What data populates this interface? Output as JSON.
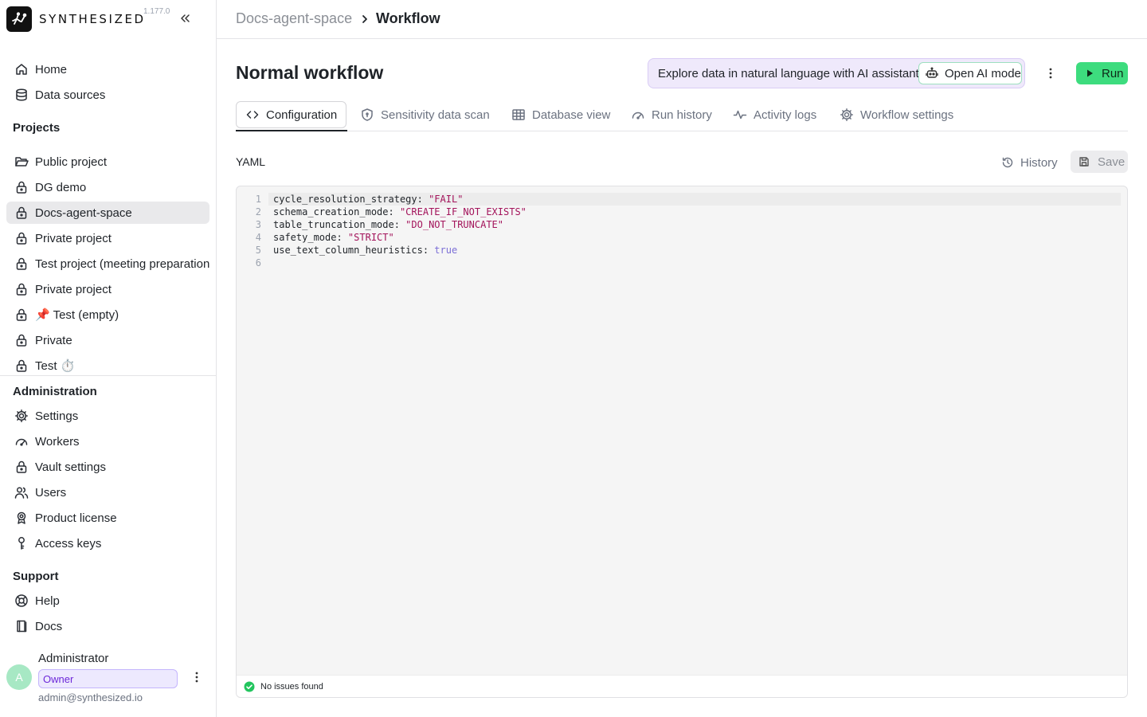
{
  "app": {
    "brand_name": "SYNTHESIZED",
    "version": "1.177.0"
  },
  "sidebar": {
    "top_items": [
      {
        "label": "Home",
        "icon": "home-icon"
      },
      {
        "label": "Data sources",
        "icon": "database-icon"
      }
    ],
    "projects_title": "Projects",
    "projects": [
      {
        "label": "Public project",
        "icon": "folder-open-icon",
        "active": false
      },
      {
        "label": "DG demo",
        "icon": "lock-icon",
        "active": false
      },
      {
        "label": "Docs-agent-space",
        "icon": "lock-icon",
        "active": true
      },
      {
        "label": "Private project",
        "icon": "lock-icon",
        "active": false
      },
      {
        "label": "Test project (meeting preparation",
        "icon": "lock-icon",
        "active": false
      },
      {
        "label": "Private project",
        "icon": "lock-icon",
        "active": false
      },
      {
        "label": "📌 Test (empty)",
        "icon": "lock-icon",
        "active": false
      },
      {
        "label": "Private",
        "icon": "lock-icon",
        "active": false
      },
      {
        "label": "Test ⏱️",
        "icon": "lock-icon",
        "active": false
      }
    ],
    "administration_title": "Administration",
    "administration": [
      {
        "label": "Settings",
        "icon": "gear-icon"
      },
      {
        "label": "Workers",
        "icon": "gauge-icon"
      },
      {
        "label": "Vault settings",
        "icon": "lock-icon"
      },
      {
        "label": "Users",
        "icon": "users-icon"
      },
      {
        "label": "Product license",
        "icon": "award-icon"
      },
      {
        "label": "Access keys",
        "icon": "key-icon"
      }
    ],
    "support_title": "Support",
    "support": [
      {
        "label": "Help",
        "icon": "lifebuoy-icon"
      },
      {
        "label": "Docs",
        "icon": "book-icon"
      }
    ],
    "user": {
      "avatar_letter": "A",
      "name": "Administrator",
      "role": "Owner",
      "email": "admin@synthesized.io"
    }
  },
  "breadcrumb": {
    "parent": "Docs-agent-space",
    "current": "Workflow"
  },
  "page": {
    "title": "Normal workflow",
    "ai_banner_text": "Explore data in natural language with AI assistant",
    "ai_button_label": "Open AI mode",
    "run_label": "Run"
  },
  "tabs": [
    {
      "label": "Configuration",
      "icon": "code-icon",
      "active": true
    },
    {
      "label": "Sensitivity data scan",
      "icon": "shield-icon",
      "active": false
    },
    {
      "label": "Database view",
      "icon": "table-icon",
      "active": false
    },
    {
      "label": "Run history",
      "icon": "gauge-icon",
      "active": false
    },
    {
      "label": "Activity logs",
      "icon": "activity-icon",
      "active": false
    },
    {
      "label": "Workflow settings",
      "icon": "gear-icon",
      "active": false
    }
  ],
  "editor": {
    "label": "YAML",
    "history_label": "History",
    "save_label": "Save",
    "lines": [
      {
        "num": "1",
        "key": "cycle_resolution_strategy: ",
        "value": "\"FAIL\"",
        "type": "string"
      },
      {
        "num": "2",
        "key": "schema_creation_mode: ",
        "value": "\"CREATE_IF_NOT_EXISTS\"",
        "type": "string"
      },
      {
        "num": "3",
        "key": "table_truncation_mode: ",
        "value": "\"DO_NOT_TRUNCATE\"",
        "type": "string"
      },
      {
        "num": "4",
        "key": "safety_mode: ",
        "value": "\"STRICT\"",
        "type": "string"
      },
      {
        "num": "5",
        "key": "use_text_column_heuristics: ",
        "value": "true",
        "type": "bool"
      },
      {
        "num": "6",
        "key": "",
        "value": "",
        "type": "empty"
      }
    ],
    "status_text": "No issues found"
  },
  "colors": {
    "run_button": "#3ddc7e",
    "ai_banner": "#efe9fb",
    "owner_badge": "#ede9fe",
    "string_value": "#a3145b",
    "bool_value": "#7c6fd6",
    "status_ok": "#22c55e"
  }
}
